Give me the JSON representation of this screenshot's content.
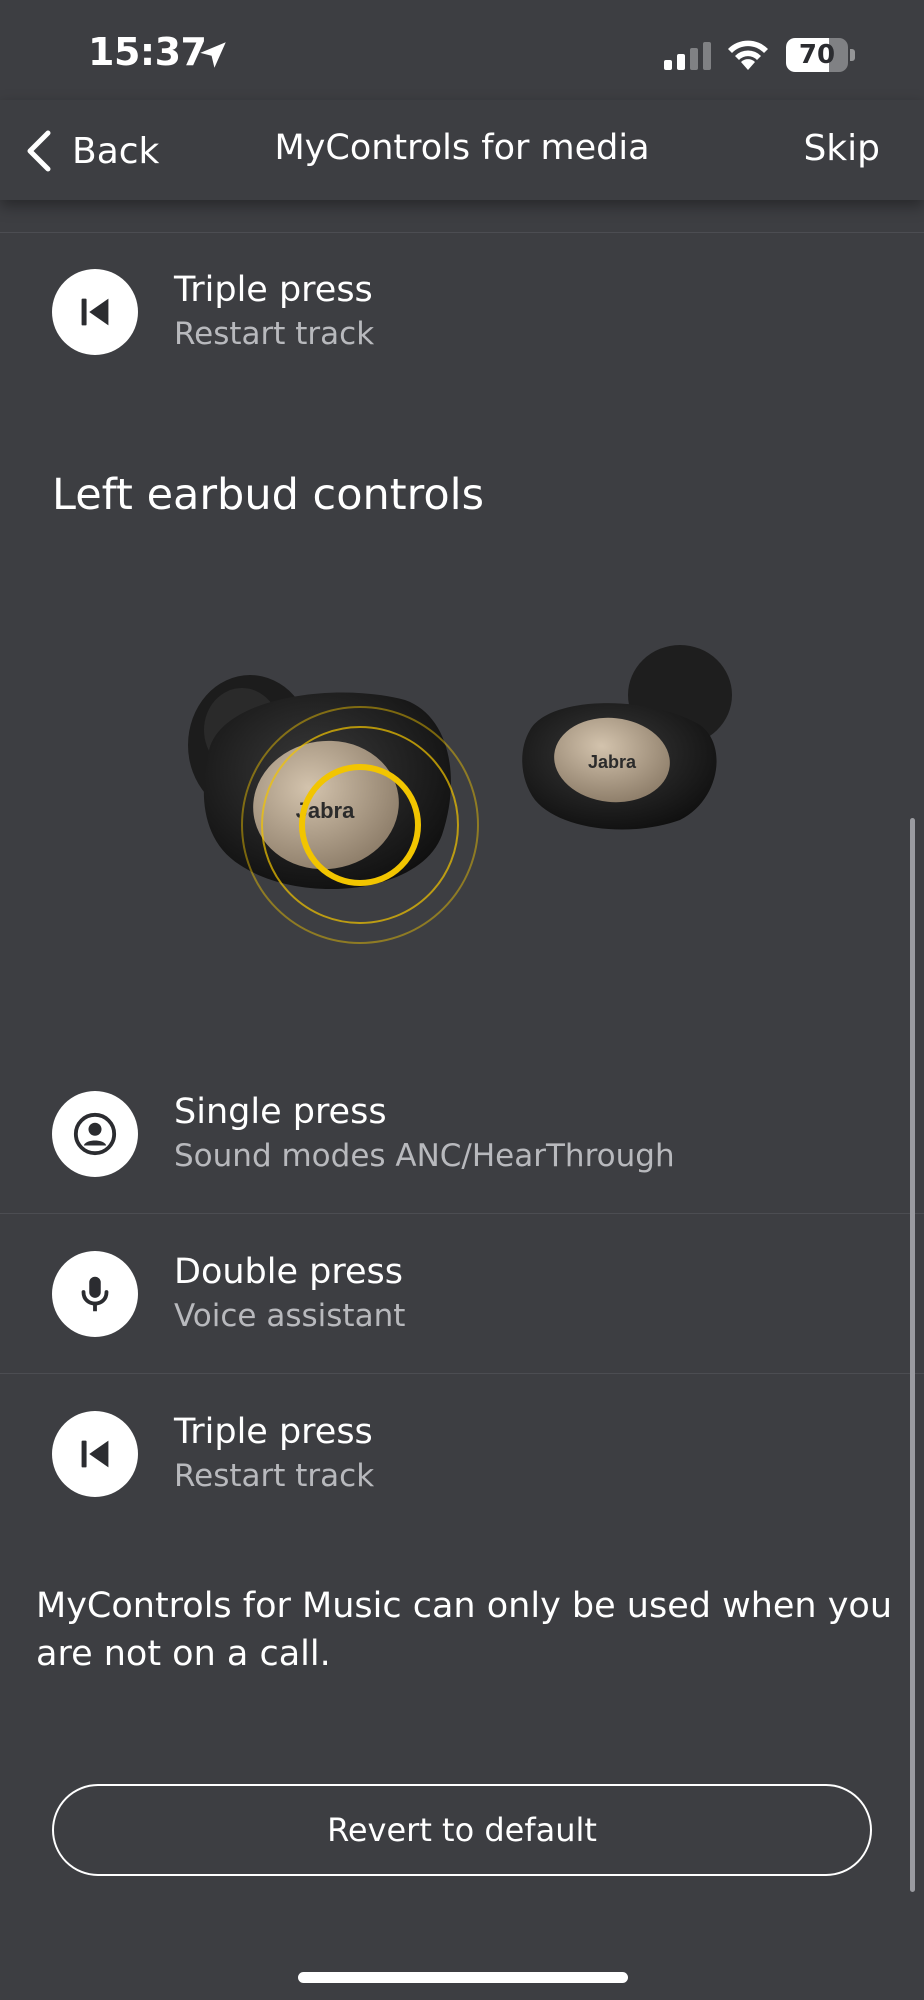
{
  "status_bar": {
    "time": "15:37",
    "battery_percent": 70,
    "battery_label": "70",
    "icons": [
      "location-arrow-icon",
      "cellular-signal-icon",
      "wifi-icon",
      "battery-icon"
    ]
  },
  "nav": {
    "back_label": "Back",
    "title": "MyControls for media",
    "skip_label": "Skip"
  },
  "top_controls": [
    {
      "title": "Triple press",
      "subtitle": "Restart track",
      "icon": "restart-track-icon"
    }
  ],
  "left_earbud": {
    "section_title": "Left earbud controls",
    "earbud_brand": "Jabra",
    "controls": [
      {
        "title": "Single press",
        "subtitle": "Sound modes ANC/HearThrough",
        "icon": "person-icon"
      },
      {
        "title": "Double press",
        "subtitle": "Voice assistant",
        "icon": "microphone-icon"
      },
      {
        "title": "Triple press",
        "subtitle": "Restart track",
        "icon": "restart-track-icon"
      }
    ]
  },
  "note": "MyControls for Music can only be used when you are not on a call.",
  "revert_label": "Revert to default",
  "colors": {
    "background": "#3d3e42",
    "text": "#ffffff",
    "subtext": "#b8b9bd",
    "accent_highlight": "#f2c500",
    "icon_circle": "#ffffff"
  }
}
